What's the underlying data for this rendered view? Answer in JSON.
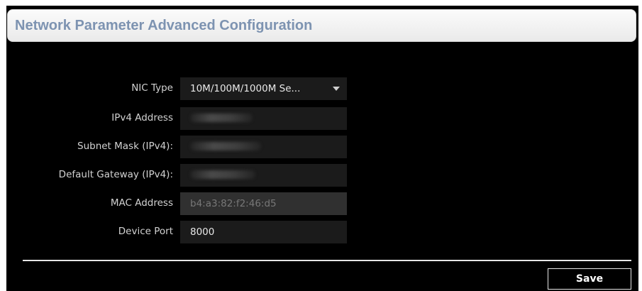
{
  "header": {
    "title": "Network Parameter Advanced Configuration"
  },
  "form": {
    "nic_type": {
      "label": "NIC Type",
      "value": "10M/100M/1000M Se..."
    },
    "ipv4_address": {
      "label": "IPv4 Address"
    },
    "subnet_mask": {
      "label": "Subnet Mask (IPv4):"
    },
    "default_gateway": {
      "label": "Default Gateway (IPv4):"
    },
    "mac_address": {
      "label": "MAC Address",
      "value": "b4:a3:82:f2:46:d5"
    },
    "device_port": {
      "label": "Device Port",
      "value": "8000"
    }
  },
  "footer": {
    "save_label": "Save"
  },
  "colors": {
    "title": "#7d93b1",
    "background": "#000000",
    "field": "#1b1b1b",
    "field_disabled": "#303030",
    "label": "#d2d2d2"
  },
  "icons": {
    "dropdown": "caret-down-icon"
  }
}
